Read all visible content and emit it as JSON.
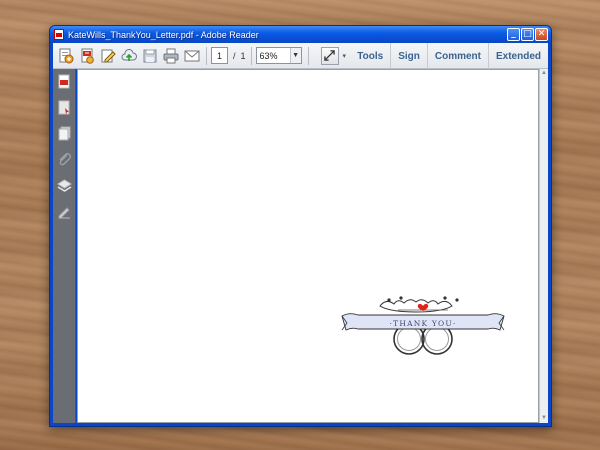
{
  "window": {
    "title": "KateWills_ThankYou_Letter.pdf - Adobe Reader",
    "controls": {
      "minimize": "_",
      "maximize": "□",
      "close": "✕"
    }
  },
  "toolbar": {
    "icons": [
      "create-pdf-icon",
      "open-pdf-icon",
      "edit-pdf-icon",
      "cloud-upload-icon",
      "save-icon",
      "print-icon",
      "email-icon"
    ],
    "page_current": "1",
    "page_separator": "/",
    "page_total": "1",
    "zoom": "63%",
    "nav": {
      "tools": "Tools",
      "sign": "Sign",
      "comment": "Comment",
      "extended": "Extended"
    }
  },
  "left_panel": {
    "icons": [
      "page-thumbnails-icon",
      "bookmarks-icon",
      "copy-pages-icon",
      "attachments-icon",
      "layers-icon",
      "signatures-icon"
    ]
  },
  "document": {
    "seal_text": "·THANK YOU·"
  },
  "colors": {
    "titlebar": "#0a4fd6",
    "nav_text": "#3a6390",
    "heart": "#e2231a",
    "banner": "#dfe4f6"
  }
}
